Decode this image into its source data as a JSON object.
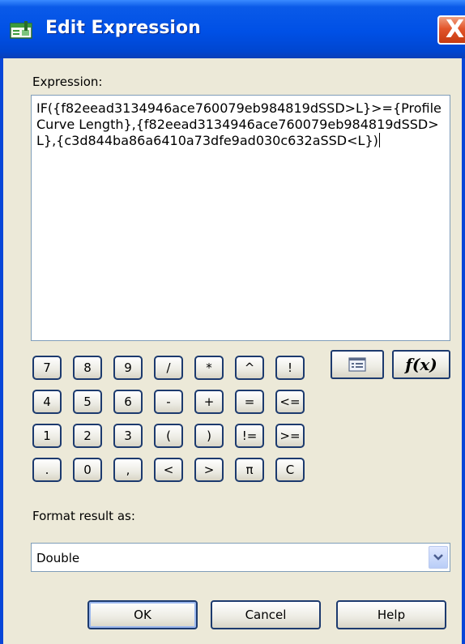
{
  "window": {
    "title": "Edit Expression",
    "close_label": "X"
  },
  "expression": {
    "label": "Expression:",
    "value": "IF({f82eead3134946ace760079eb984819dSSD>L}>={Profile Curve Length},{f82eead3134946ace760079eb984819dSSD>L},{c3d844ba86a6410a73dfe9ad030c632aSSD<L})"
  },
  "keypad": {
    "rows": [
      [
        "7",
        "8",
        "9",
        "/",
        "*",
        "^",
        "!"
      ],
      [
        "4",
        "5",
        "6",
        "-",
        "+",
        "=",
        "<="
      ],
      [
        "1",
        "2",
        "3",
        "(",
        ")",
        "!=",
        ">="
      ],
      [
        ".",
        "0",
        ",",
        "<",
        ">",
        "π",
        "C"
      ]
    ]
  },
  "tools": {
    "list_icon": "list-icon",
    "function_label": "f(x)"
  },
  "format": {
    "label": "Format result as:",
    "selected": "Double",
    "arrow_icon": "chevron-down-icon"
  },
  "buttons": {
    "ok": "OK",
    "cancel": "Cancel",
    "help": "Help"
  }
}
